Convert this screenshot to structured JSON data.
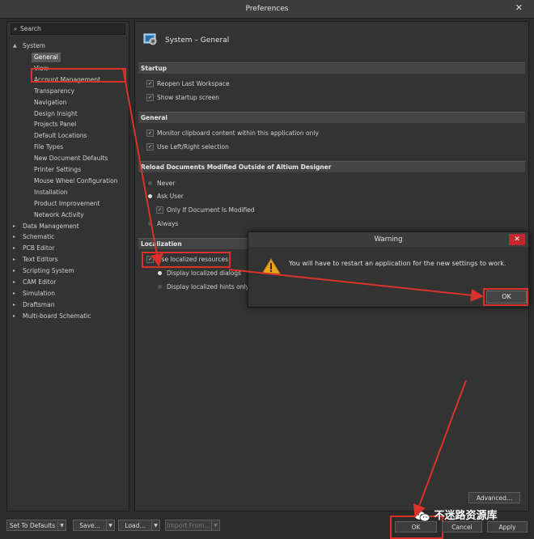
{
  "window": {
    "title": "Preferences",
    "close": "✕"
  },
  "search": {
    "placeholder": "Search",
    "icon": "search-icon"
  },
  "tree": {
    "system": "System",
    "system_children": [
      "General",
      "View",
      "Account Management",
      "Transparency",
      "Navigation",
      "Design Insight",
      "Projects Panel",
      "Default Locations",
      "File Types",
      "New Document Defaults",
      "Printer Settings",
      "Mouse Wheel Configuration",
      "Installation",
      "Product Improvement",
      "Network Activity"
    ],
    "others": [
      "Data Management",
      "Schematic",
      "PCB Editor",
      "Text Editors",
      "Scripting System",
      "CAM Editor",
      "Simulation",
      "Draftsman",
      "Multi-board Schematic"
    ]
  },
  "page": {
    "title": "System – General",
    "startup": {
      "header": "Startup",
      "reopen": "Reopen Last Workspace",
      "splash": "Show startup screen"
    },
    "general": {
      "header": "General",
      "clipboard": "Monitor clipboard content within this application only",
      "leftright": "Use Left/Right selection"
    },
    "reload": {
      "header": "Reload Documents Modified Outside of Altium Designer",
      "never": "Never",
      "ask": "Ask User",
      "only_if": "Only If Document Is Modified",
      "always": "Always"
    },
    "localization": {
      "header": "Localization",
      "use_localized": "Use localized resources",
      "dialogs": "Display localized dialogs",
      "hints": "Display localized hints only"
    },
    "advanced": "Advanced..."
  },
  "warning": {
    "title": "Warning",
    "close": "✕",
    "message": "You will have to restart an application for the new settings to work.",
    "ok": "OK"
  },
  "footer": {
    "set_defaults": "Set To Defaults",
    "save": "Save...",
    "load": "Load...",
    "import": "Import From...",
    "ok": "OK",
    "cancel": "Cancel",
    "apply": "Apply"
  },
  "watermark": "不迷路资源库",
  "colors": {
    "highlight": "#d9322b",
    "panel": "#333333",
    "background": "#2b2b2b"
  }
}
